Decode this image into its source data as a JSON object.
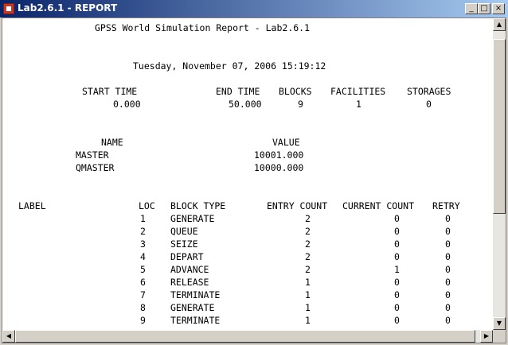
{
  "window": {
    "title": "Lab2.6.1 - REPORT",
    "minimize": "_",
    "maximize": "□",
    "close": "×"
  },
  "report": {
    "header": "GPSS World Simulation Report - Lab2.6.1",
    "date": "Tuesday, November 07, 2006 15:19:12",
    "summary": {
      "headers": [
        "START TIME",
        "END TIME",
        "BLOCKS",
        "FACILITIES",
        "STORAGES"
      ],
      "values": [
        "0.000",
        "50.000",
        "9",
        "1",
        "0"
      ]
    },
    "names": {
      "headers": [
        "NAME",
        "VALUE"
      ],
      "rows": [
        {
          "name": "MASTER",
          "value": "10001.000"
        },
        {
          "name": "QMASTER",
          "value": "10000.000"
        }
      ]
    },
    "blocks": {
      "headers": [
        "LABEL",
        "LOC",
        "BLOCK TYPE",
        "ENTRY COUNT",
        "CURRENT COUNT",
        "RETRY"
      ],
      "rows": [
        {
          "loc": "1",
          "type": "GENERATE",
          "entry": "2",
          "current": "0",
          "retry": "0"
        },
        {
          "loc": "2",
          "type": "QUEUE",
          "entry": "2",
          "current": "0",
          "retry": "0"
        },
        {
          "loc": "3",
          "type": "SEIZE",
          "entry": "2",
          "current": "0",
          "retry": "0"
        },
        {
          "loc": "4",
          "type": "DEPART",
          "entry": "2",
          "current": "0",
          "retry": "0"
        },
        {
          "loc": "5",
          "type": "ADVANCE",
          "entry": "2",
          "current": "1",
          "retry": "0"
        },
        {
          "loc": "6",
          "type": "RELEASE",
          "entry": "1",
          "current": "0",
          "retry": "0"
        },
        {
          "loc": "7",
          "type": "TERMINATE",
          "entry": "1",
          "current": "0",
          "retry": "0"
        },
        {
          "loc": "8",
          "type": "GENERATE",
          "entry": "1",
          "current": "0",
          "retry": "0"
        },
        {
          "loc": "9",
          "type": "TERMINATE",
          "entry": "1",
          "current": "0",
          "retry": "0"
        }
      ]
    }
  },
  "scrollbars": {
    "up": "▲",
    "down": "▼",
    "left": "◀",
    "right": "▶"
  }
}
